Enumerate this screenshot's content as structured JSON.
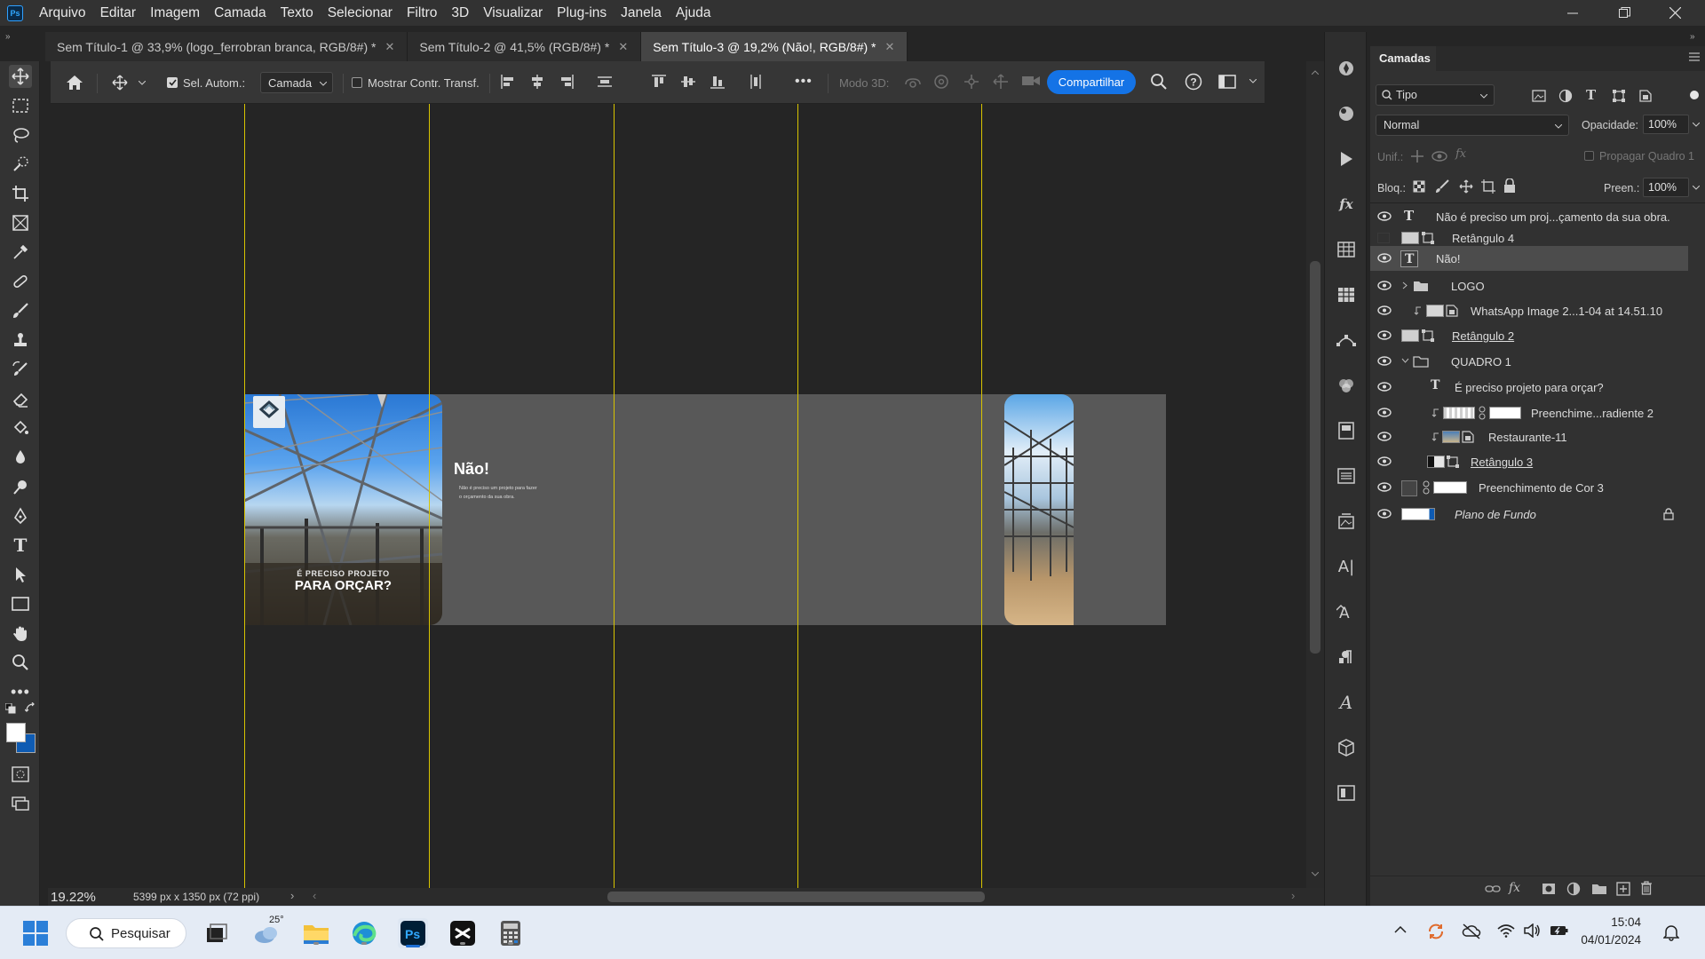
{
  "menubar": {
    "app_icon": "Ps",
    "items": [
      "Arquivo",
      "Editar",
      "Imagem",
      "Camada",
      "Texto",
      "Selecionar",
      "Filtro",
      "3D",
      "Visualizar",
      "Plug-ins",
      "Janela",
      "Ajuda"
    ]
  },
  "tabs": [
    {
      "label": "Sem Título-1 @ 33,9% (logo_ferrobran branca, RGB/8#) *",
      "active": false
    },
    {
      "label": "Sem Título-2 @ 41,5% (RGB/8#) *",
      "active": false
    },
    {
      "label": "Sem Título-3 @ 19,2% (Não!, RGB/8#) *",
      "active": true
    }
  ],
  "options": {
    "auto_select_label": "Sel. Autom.:",
    "auto_select_checked": true,
    "target_value": "Camada",
    "transform_label": "Mostrar Contr. Transf.",
    "transform_checked": false,
    "mode3d_label": "Modo 3D:",
    "share_label": "Compartilhar"
  },
  "artboard": {
    "left_caption_small": "É PRECISO PROJETO",
    "left_caption_big": "PARA ORÇAR?",
    "heading": "Não!",
    "body": "Não é preciso um projeto para fazer o orçamento da sua obra."
  },
  "status": {
    "zoom": "19.22%",
    "doc_size": "5399 px x 1350 px (72 ppi)"
  },
  "layers_panel": {
    "title": "Camadas",
    "filter_label": "Tipo",
    "blend_mode": "Normal",
    "opacity_label": "Opacidade:",
    "opacity_value": "100%",
    "unify_label": "Unif.:",
    "propagate_label": "Propagar Quadro 1",
    "lock_label": "Bloq.:",
    "fill_label": "Preen.:",
    "fill_value": "100%",
    "layers": [
      {
        "name": "Não é preciso um proj...çamento da sua obra.",
        "kind": "text",
        "visible": true,
        "selected": false
      },
      {
        "name": "Retângulo 4",
        "kind": "shape",
        "visible": false,
        "selected": false
      },
      {
        "name": "Não!",
        "kind": "text",
        "visible": true,
        "selected": true
      },
      {
        "name": "LOGO",
        "kind": "group",
        "visible": true,
        "selected": false
      },
      {
        "name": "WhatsApp Image 2...1-04 at 14.51.10",
        "kind": "smart",
        "visible": true,
        "selected": false
      },
      {
        "name": "Retângulo 2",
        "kind": "shape",
        "visible": true,
        "selected": false
      },
      {
        "name": "QUADRO 1",
        "kind": "group-open",
        "visible": true,
        "selected": false
      },
      {
        "name": "É preciso projeto  para orçar?",
        "kind": "text",
        "visible": true,
        "selected": false
      },
      {
        "name": "Preenchime...radiente 2",
        "kind": "fill",
        "visible": true,
        "selected": false
      },
      {
        "name": "Restaurante-11",
        "kind": "smart",
        "visible": true,
        "selected": false
      },
      {
        "name": "Retângulo 3",
        "kind": "shape",
        "visible": true,
        "selected": false
      },
      {
        "name": "Preenchimento de Cor 3",
        "kind": "fill",
        "visible": true,
        "selected": false
      },
      {
        "name": "Plano de Fundo",
        "kind": "background",
        "visible": true,
        "selected": false
      }
    ]
  },
  "taskbar": {
    "search_label": "Pesquisar",
    "weather": "25°",
    "time": "15:04",
    "date": "04/01/2024"
  },
  "colors": {
    "accent": "#1473e6",
    "guide": "#d8c400",
    "selected_layer": "#4c4c4c"
  }
}
